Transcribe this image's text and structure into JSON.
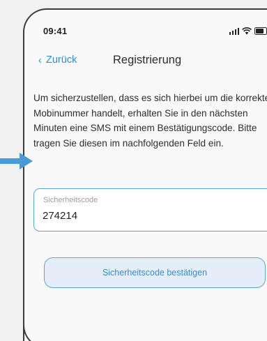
{
  "status_bar": {
    "time": "09:41",
    "icons": [
      "signal-icon",
      "wifi-icon",
      "battery-icon"
    ]
  },
  "nav": {
    "back_label": "Zurück",
    "back_icon": "chevron-left-icon",
    "title": "Registrierung"
  },
  "main": {
    "instructions": "Um sicherzustellen, dass es sich hierbei um die korrekte Mobinummer handelt, erhalten Sie in den nächsten Minuten eine SMS mit einem Bestätigungscode. Bitte tragen Sie diesen im nachfolgenden Feld ein.",
    "code_field": {
      "label": "Sicherheitscode",
      "value": "274214"
    },
    "confirm_button_label": "Sicherheitscode bestätigen"
  },
  "annotation": {
    "arrow_icon": "arrow-right-icon"
  },
  "colors": {
    "accent": "#2a8fd6",
    "field_border": "#5aa5de",
    "button_fill": "#e5eef8",
    "arrow": "#4a9ad8"
  }
}
